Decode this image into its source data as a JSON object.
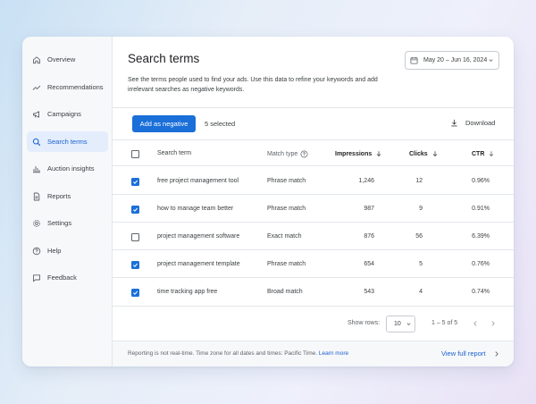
{
  "sidebar": {
    "items": [
      {
        "label": "Overview",
        "icon": "home-icon",
        "active": false
      },
      {
        "label": "Recommendations",
        "icon": "trend-icon",
        "active": false
      },
      {
        "label": "Campaigns",
        "icon": "megaphone-icon",
        "active": false
      },
      {
        "label": "Search terms",
        "icon": "search-icon",
        "active": true
      },
      {
        "label": "Auction insights",
        "icon": "bar-chart-icon",
        "active": false
      },
      {
        "label": "Reports",
        "icon": "document-icon",
        "active": false
      },
      {
        "label": "Settings",
        "icon": "gear-icon",
        "active": false
      },
      {
        "label": "Help",
        "icon": "help-icon",
        "active": false
      },
      {
        "label": "Feedback",
        "icon": "feedback-icon",
        "active": false
      }
    ]
  },
  "header": {
    "title": "Search terms",
    "description": "See the terms people used to find your ads. Use this data to refine your keywords and add irrelevant searches as negative keywords.",
    "date_range": "May 20 – Jun 16, 2024"
  },
  "toolbar": {
    "add_negative_label": "Add as negative",
    "selected_text": "5 selected",
    "download_label": "Download"
  },
  "table": {
    "columns": {
      "search_term": "Search term",
      "match_type": "Match type",
      "impressions": "Impressions",
      "clicks": "Clicks",
      "ctr": "CTR"
    },
    "rows": [
      {
        "term": "free project management tool",
        "match": "Phrase match",
        "impressions": "1,246",
        "clicks": "12",
        "ctr": "0.96%",
        "checked": true
      },
      {
        "term": "how to manage team better",
        "match": "Phrase match",
        "impressions": "987",
        "clicks": "9",
        "ctr": "0.91%",
        "checked": true
      },
      {
        "term": "project management software",
        "match": "Exact match",
        "impressions": "876",
        "clicks": "56",
        "ctr": "6.39%",
        "checked": false
      },
      {
        "term": "project management template",
        "match": "Phrase match",
        "impressions": "654",
        "clicks": "5",
        "ctr": "0.76%",
        "checked": true
      },
      {
        "term": "time tracking app free",
        "match": "Broad match",
        "impressions": "543",
        "clicks": "4",
        "ctr": "0.74%",
        "checked": true
      }
    ]
  },
  "pagination": {
    "rows_label": "Show rows:",
    "rows_value": "10",
    "range_text": "1 – 5 of 5"
  },
  "footer": {
    "note": "Reporting is not real-time. Time zone for all dates and times: Pacific Time.",
    "learn_more": "Learn more",
    "view_full_report": "View full report"
  },
  "colors": {
    "accent": "#1a6fd9",
    "active_nav_bg": "#e3edfc",
    "text": "#3c4043"
  }
}
